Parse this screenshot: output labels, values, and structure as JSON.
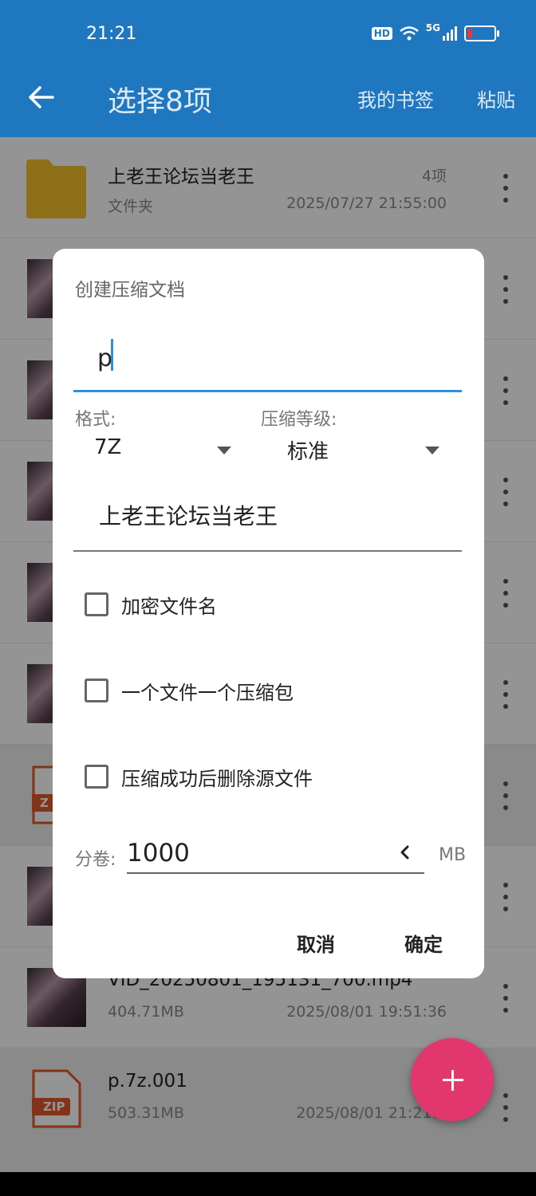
{
  "status_bar": {
    "time": "21:21",
    "hd": "HD",
    "network": "5G"
  },
  "app_bar": {
    "title": "选择8项",
    "bookmarks_label": "我的书签",
    "paste_label": "粘贴"
  },
  "list": {
    "folder": {
      "name": "上老王论坛当老王",
      "type": "文件夹",
      "count": "4项",
      "date": "2025/07/27 21:55:00"
    },
    "video": {
      "name": "VID_20250801_195131_700.mp4",
      "size": "404.71MB",
      "date": "2025/08/01 19:51:36"
    },
    "zip_file": {
      "name": "p.7z.001",
      "size": "503.31MB",
      "date": "2025/08/01 21:21:0",
      "badge": "ZIP"
    },
    "zip_badge_partial": "Z"
  },
  "dialog": {
    "title": "创建压缩文档",
    "archive_name": "p",
    "format_label": "格式:",
    "format_value": "7Z",
    "level_label": "压缩等级:",
    "level_value": "标准",
    "folder_name": "上老王论坛当老王",
    "options": {
      "encrypt": {
        "label": "加密文件名",
        "checked": false
      },
      "one_per_file": {
        "label": "一个文件一个压缩包",
        "checked": false
      },
      "delete_source": {
        "label": "压缩成功后删除源文件",
        "checked": false
      }
    },
    "split_label": "分卷:",
    "split_value": "1000",
    "split_unit": "MB",
    "cancel": "取消",
    "ok": "确定"
  },
  "colors": {
    "primary": "#1f77bf",
    "accent": "#2f8fd8",
    "fab": "#e2366f",
    "folder": "#f5c12e",
    "zip": "#e2582a"
  }
}
